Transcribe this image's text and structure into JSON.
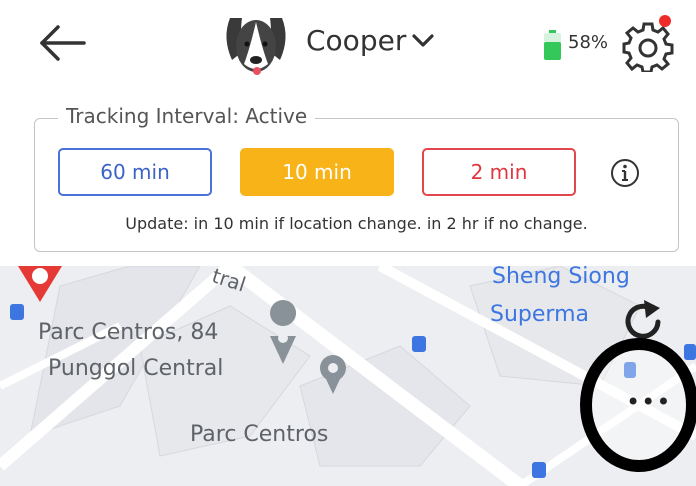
{
  "header": {
    "pet_name": "Cooper",
    "battery_percent": "58%"
  },
  "tracking": {
    "title": "Tracking Interval: Active",
    "options": [
      "60 min",
      "10 min",
      "2 min"
    ],
    "selected": "10 min",
    "update_text": "Update: in 10 min if location change. in 2 hr if no change."
  },
  "map": {
    "labels": [
      "Parc Centros, 84",
      "Punggol Central",
      "Parc Centros",
      "Sheng Siong",
      "Superma",
      "tral"
    ]
  },
  "colors": {
    "accent_blue": "#4a72d6",
    "selected_yellow": "#f7b318",
    "red": "#e2474f",
    "battery_green": "#34c759"
  },
  "icons": [
    "back-arrow-icon",
    "dog-avatar-icon",
    "chevron-down-icon",
    "battery-icon",
    "gear-icon",
    "info-icon",
    "refresh-icon",
    "more-icon",
    "map-pin-icon",
    "bus-stop-icon"
  ]
}
